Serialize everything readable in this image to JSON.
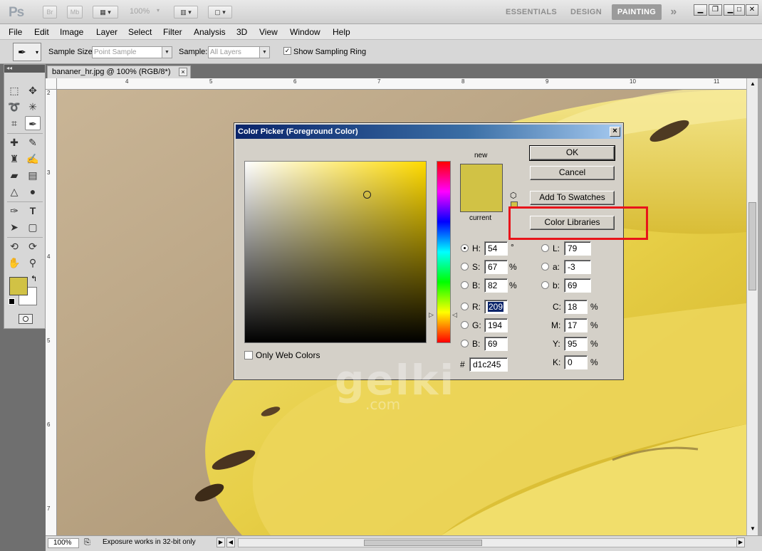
{
  "app": {
    "logo": "Ps",
    "bridge_label": "Br",
    "minibridge_label": "Mb",
    "zoom": "100%",
    "workspaces": [
      "ESSENTIALS",
      "DESIGN",
      "PAINTING"
    ],
    "active_workspace": "PAINTING",
    "more": "»"
  },
  "menu": [
    "File",
    "Edit",
    "Image",
    "Layer",
    "Select",
    "Filter",
    "Analysis",
    "3D",
    "View",
    "Window",
    "Help"
  ],
  "options": {
    "sample_size_label": "Sample Size:",
    "sample_size_value": "Point Sample",
    "sample_label": "Sample:",
    "sample_value": "All Layers",
    "show_ring_label": "Show Sampling Ring",
    "show_ring_checked": true
  },
  "tools_collapse": "◂◂",
  "document": {
    "tab_title": "bananer_hr.jpg @ 100% (RGB/8*)",
    "tab_close": "×",
    "ruler_top": [
      "4",
      "5",
      "6",
      "7",
      "8",
      "9",
      "10",
      "11"
    ],
    "ruler_left": [
      "2",
      "3",
      "4",
      "5",
      "6",
      "7"
    ]
  },
  "status": {
    "zoom": "100%",
    "message": "Exposure works in 32-bit only"
  },
  "dialog": {
    "title": "Color Picker (Foreground Color)",
    "close": "×",
    "new_label": "new",
    "current_label": "current",
    "new_color": "#d1c245",
    "current_color": "#d1c245",
    "buttons": {
      "ok": "OK",
      "cancel": "Cancel",
      "add_to_swatches": "Add To Swatches",
      "color_libraries": "Color Libraries"
    },
    "hsb": {
      "h": {
        "label": "H:",
        "value": "54",
        "unit": "°"
      },
      "s": {
        "label": "S:",
        "value": "67",
        "unit": "%"
      },
      "b": {
        "label": "B:",
        "value": "82",
        "unit": "%"
      }
    },
    "rgb": {
      "r": {
        "label": "R:",
        "value": "209"
      },
      "g": {
        "label": "G:",
        "value": "194"
      },
      "b": {
        "label": "B:",
        "value": "69"
      }
    },
    "lab": {
      "l": {
        "label": "L:",
        "value": "79"
      },
      "a": {
        "label": "a:",
        "value": "-3"
      },
      "b": {
        "label": "b:",
        "value": "69"
      }
    },
    "cmyk": {
      "c": {
        "label": "C:",
        "value": "18",
        "unit": "%"
      },
      "m": {
        "label": "M:",
        "value": "17",
        "unit": "%"
      },
      "y": {
        "label": "Y:",
        "value": "95",
        "unit": "%"
      },
      "k": {
        "label": "K:",
        "value": "0",
        "unit": "%"
      }
    },
    "hex_label": "#",
    "hex_value": "d1c245",
    "only_web_colors": "Only Web Colors"
  },
  "watermark": {
    "main": "gelki",
    "sub": ".com"
  },
  "colors": {
    "foreground": "#d1c245",
    "background": "#ffffff",
    "highlight": "#e8141a"
  }
}
